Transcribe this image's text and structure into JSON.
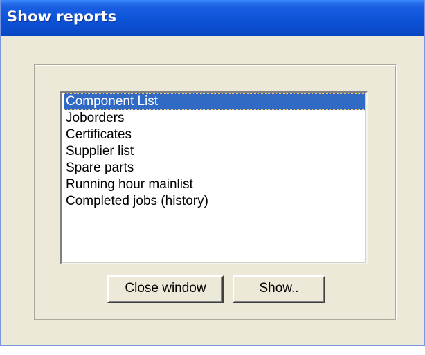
{
  "window": {
    "title": "Show reports"
  },
  "reports_list": {
    "selected_index": 0,
    "items": [
      {
        "label": "Component List"
      },
      {
        "label": "Joborders"
      },
      {
        "label": "Certificates"
      },
      {
        "label": "Supplier list"
      },
      {
        "label": "Spare parts"
      },
      {
        "label": "Running hour mainlist"
      },
      {
        "label": "Completed jobs (history)"
      }
    ]
  },
  "buttons": {
    "close_label": "Close window",
    "show_label": "Show.."
  },
  "colors": {
    "title_bar": "#0e54d9",
    "window_face": "#ece9d8",
    "selection": "#316ac5"
  }
}
